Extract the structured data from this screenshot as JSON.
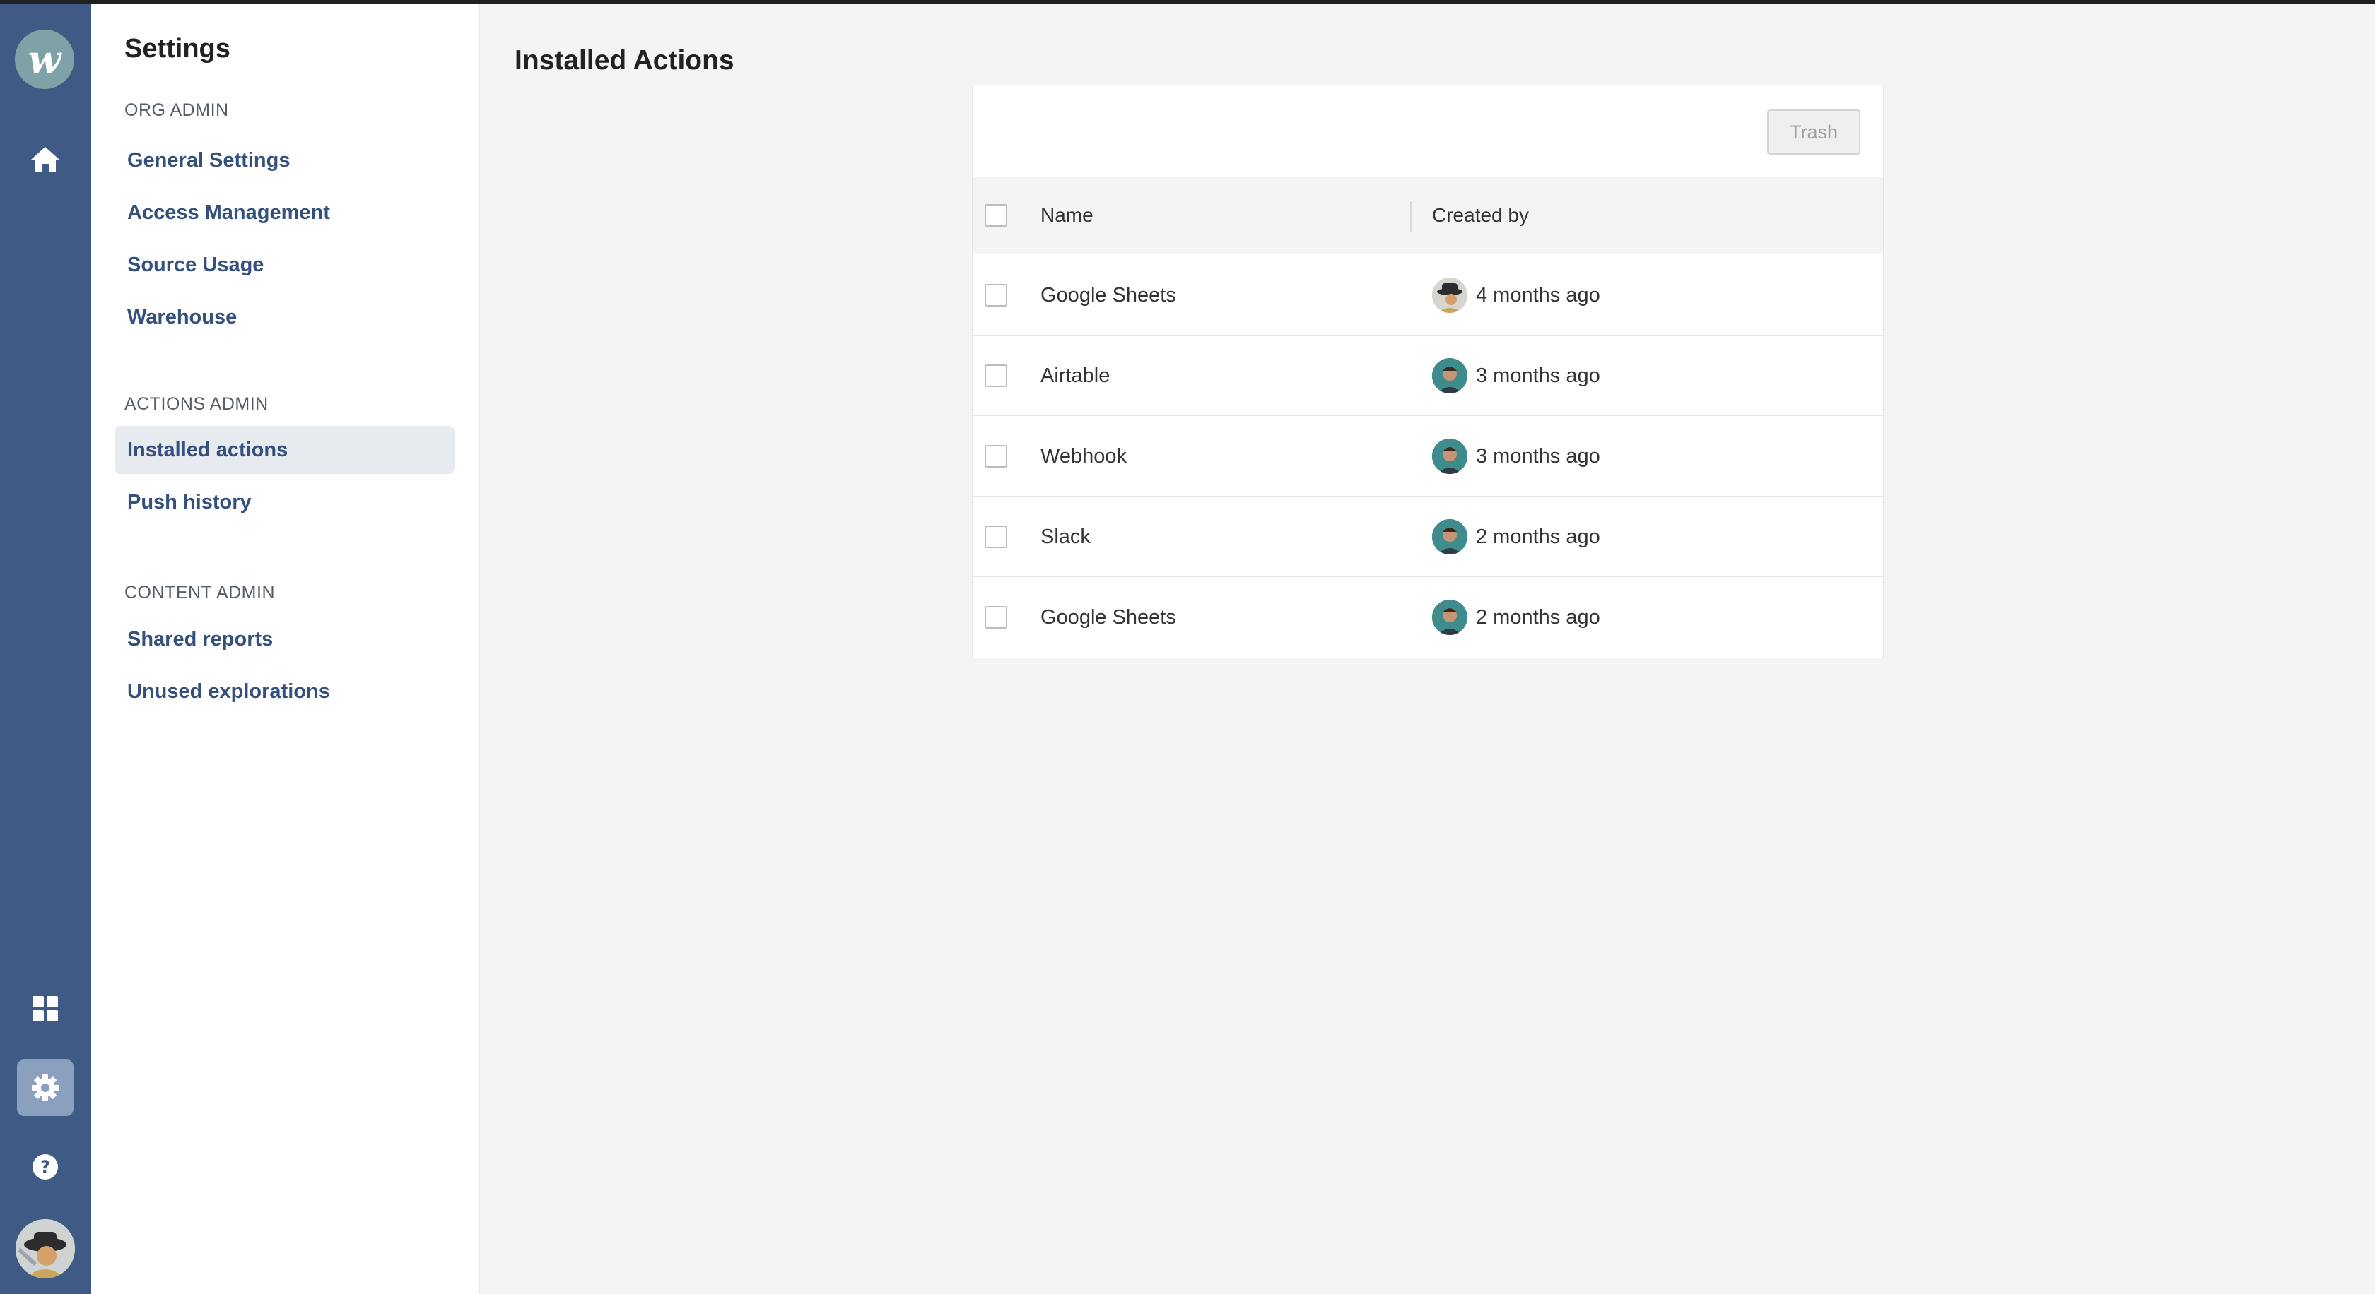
{
  "app": {
    "logo_letter": "w",
    "rail_icons": [
      "home-icon",
      "grid-icon",
      "gear-icon",
      "help-icon"
    ]
  },
  "sidebar": {
    "title": "Settings",
    "sections": [
      {
        "label": "ORG ADMIN",
        "items": [
          "General Settings",
          "Access Management",
          "Source Usage",
          "Warehouse"
        ]
      },
      {
        "label": "ACTIONS ADMIN",
        "items": [
          "Installed actions",
          "Push history"
        ]
      },
      {
        "label": "CONTENT ADMIN",
        "items": [
          "Shared reports",
          "Unused explorations"
        ]
      }
    ],
    "active_item": "Installed actions"
  },
  "main": {
    "title": "Installed Actions",
    "trash_label": "Trash",
    "columns": [
      "Name",
      "Created by"
    ],
    "rows": [
      {
        "name": "Google Sheets",
        "created": "4 months ago"
      },
      {
        "name": "Airtable",
        "created": "3 months ago"
      },
      {
        "name": "Webhook",
        "created": "3 months ago"
      },
      {
        "name": "Slack",
        "created": "2 months ago"
      },
      {
        "name": "Google Sheets",
        "created": "2 months ago"
      }
    ]
  },
  "colors": {
    "rail": "#3e5a85",
    "link": "#34507d",
    "active_bg": "#e7eaee"
  }
}
